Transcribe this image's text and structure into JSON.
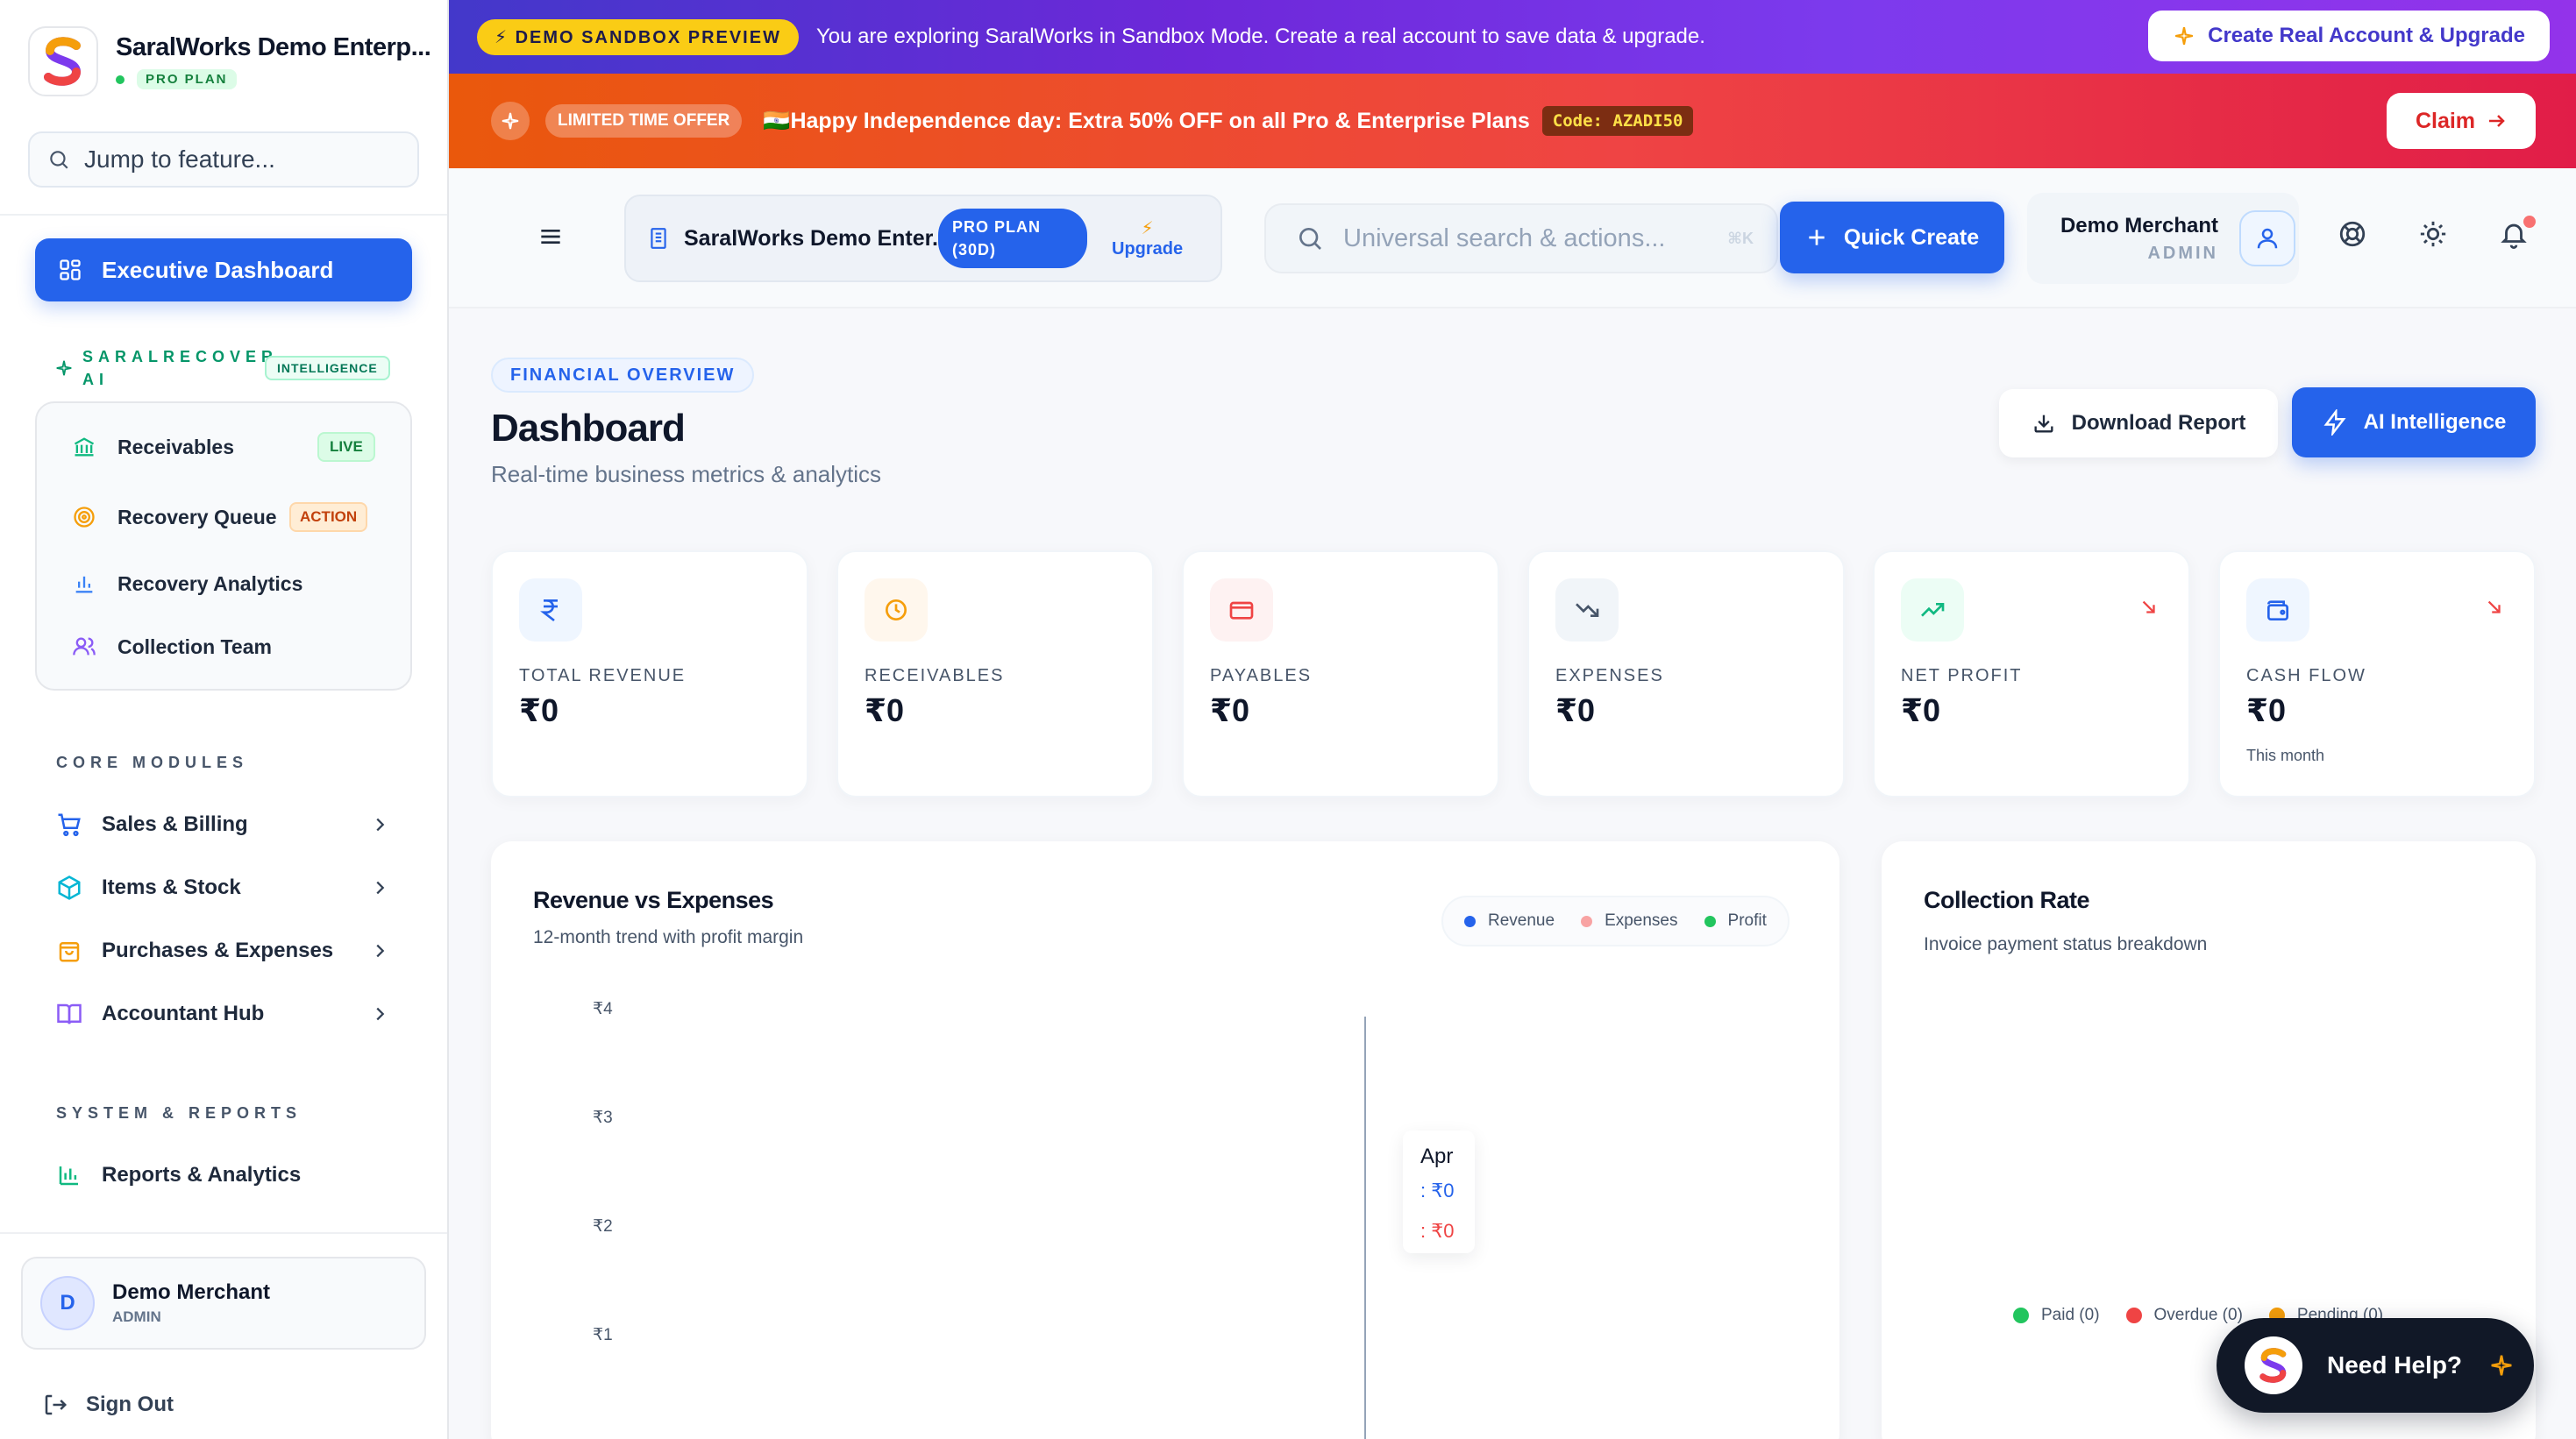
{
  "brand": {
    "name": "SaralWorks Demo Enterp...",
    "plan": "PRO PLAN"
  },
  "sidebar": {
    "search_placeholder": "Jump to feature...",
    "active_item": "Executive Dashboard",
    "recover_section": {
      "title": "SARALRECOVER AI",
      "badge": "INTELLIGENCE",
      "items": [
        {
          "label": "Receivables",
          "badge": "LIVE",
          "icon": "bank-icon"
        },
        {
          "label": "Recovery Queue",
          "badge": "ACTION",
          "icon": "target-icon"
        },
        {
          "label": "Recovery Analytics",
          "icon": "bar-chart-icon"
        },
        {
          "label": "Collection Team",
          "icon": "users-icon"
        }
      ]
    },
    "core_title": "CORE MODULES",
    "core_items": [
      {
        "label": "Sales & Billing",
        "icon": "cart-icon"
      },
      {
        "label": "Items & Stock",
        "icon": "box-icon"
      },
      {
        "label": "Purchases & Expenses",
        "icon": "bag-icon"
      },
      {
        "label": "Accountant Hub",
        "icon": "book-icon"
      }
    ],
    "system_title": "SYSTEM & REPORTS",
    "system_items": [
      {
        "label": "Reports & Analytics",
        "icon": "bar-chart-icon"
      }
    ],
    "user": {
      "initial": "D",
      "name": "Demo Merchant",
      "role": "ADMIN"
    },
    "signout_label": "Sign Out"
  },
  "banners": {
    "demo_pill": "⚡ DEMO SANDBOX PREVIEW",
    "demo_text": "You are exploring SaralWorks in Sandbox Mode. Create a real account to save data & upgrade.",
    "create_button": "Create Real Account & Upgrade",
    "offer_pill": "LIMITED TIME OFFER",
    "offer_text": "🇮🇳Happy Independence day: Extra 50% OFF on all Pro & Enterprise Plans",
    "offer_code": "Code: AZADI50",
    "claim_button": "Claim"
  },
  "header": {
    "company_name": "SaralWorks Demo Enter...",
    "plan_badge": "PRO PLAN (30D)",
    "upgrade_label": "Upgrade",
    "search_placeholder": "Universal search & actions...",
    "search_shortcut": "⌘K",
    "quick_create": "Quick Create",
    "merchant_name": "Demo Merchant",
    "merchant_role": "ADMIN"
  },
  "page": {
    "eyebrow": "FINANCIAL OVERVIEW",
    "title": "Dashboard",
    "subtitle": "Real-time business metrics & analytics",
    "download_button": "Download Report",
    "ai_button": "AI Intelligence"
  },
  "stats": [
    {
      "label": "TOTAL REVENUE",
      "value": "₹0",
      "icon": "rupee-icon",
      "color": "#2563eb"
    },
    {
      "label": "RECEIVABLES",
      "value": "₹0",
      "icon": "clock-icon",
      "color": "#f59e0b"
    },
    {
      "label": "PAYABLES",
      "value": "₹0",
      "icon": "credit-card-icon",
      "color": "#ef4444"
    },
    {
      "label": "EXPENSES",
      "value": "₹0",
      "icon": "trending-down-icon",
      "color": "#475569"
    },
    {
      "label": "NET PROFIT",
      "value": "₹0",
      "icon": "trending-up-icon",
      "color": "#10b981"
    },
    {
      "label": "CASH FLOW",
      "value": "₹0",
      "note": "This month",
      "icon": "wallet-icon",
      "color": "#2563eb"
    }
  ],
  "revenue_chart": {
    "title": "Revenue vs Expenses",
    "subtitle": "12-month trend with profit margin",
    "legend": [
      {
        "label": "Revenue",
        "color": "#2563eb"
      },
      {
        "label": "Expenses",
        "color": "#f8a3a3"
      },
      {
        "label": "Profit",
        "color": "#22c55e"
      }
    ],
    "y_ticks": [
      "₹4",
      "₹3",
      "₹2",
      "₹1"
    ],
    "tooltip": {
      "month": "Apr",
      "revenue": ": ₹0",
      "expenses": ": ₹0"
    }
  },
  "collection_rate": {
    "title": "Collection Rate",
    "subtitle": "Invoice payment status breakdown",
    "legend": [
      {
        "label": "Paid (0)",
        "color": "#22c55e"
      },
      {
        "label": "Overdue (0)",
        "color": "#ef4444"
      },
      {
        "label": "Pending (0)",
        "color": "#f59e0b"
      }
    ]
  },
  "help": {
    "label": "Need Help?"
  }
}
